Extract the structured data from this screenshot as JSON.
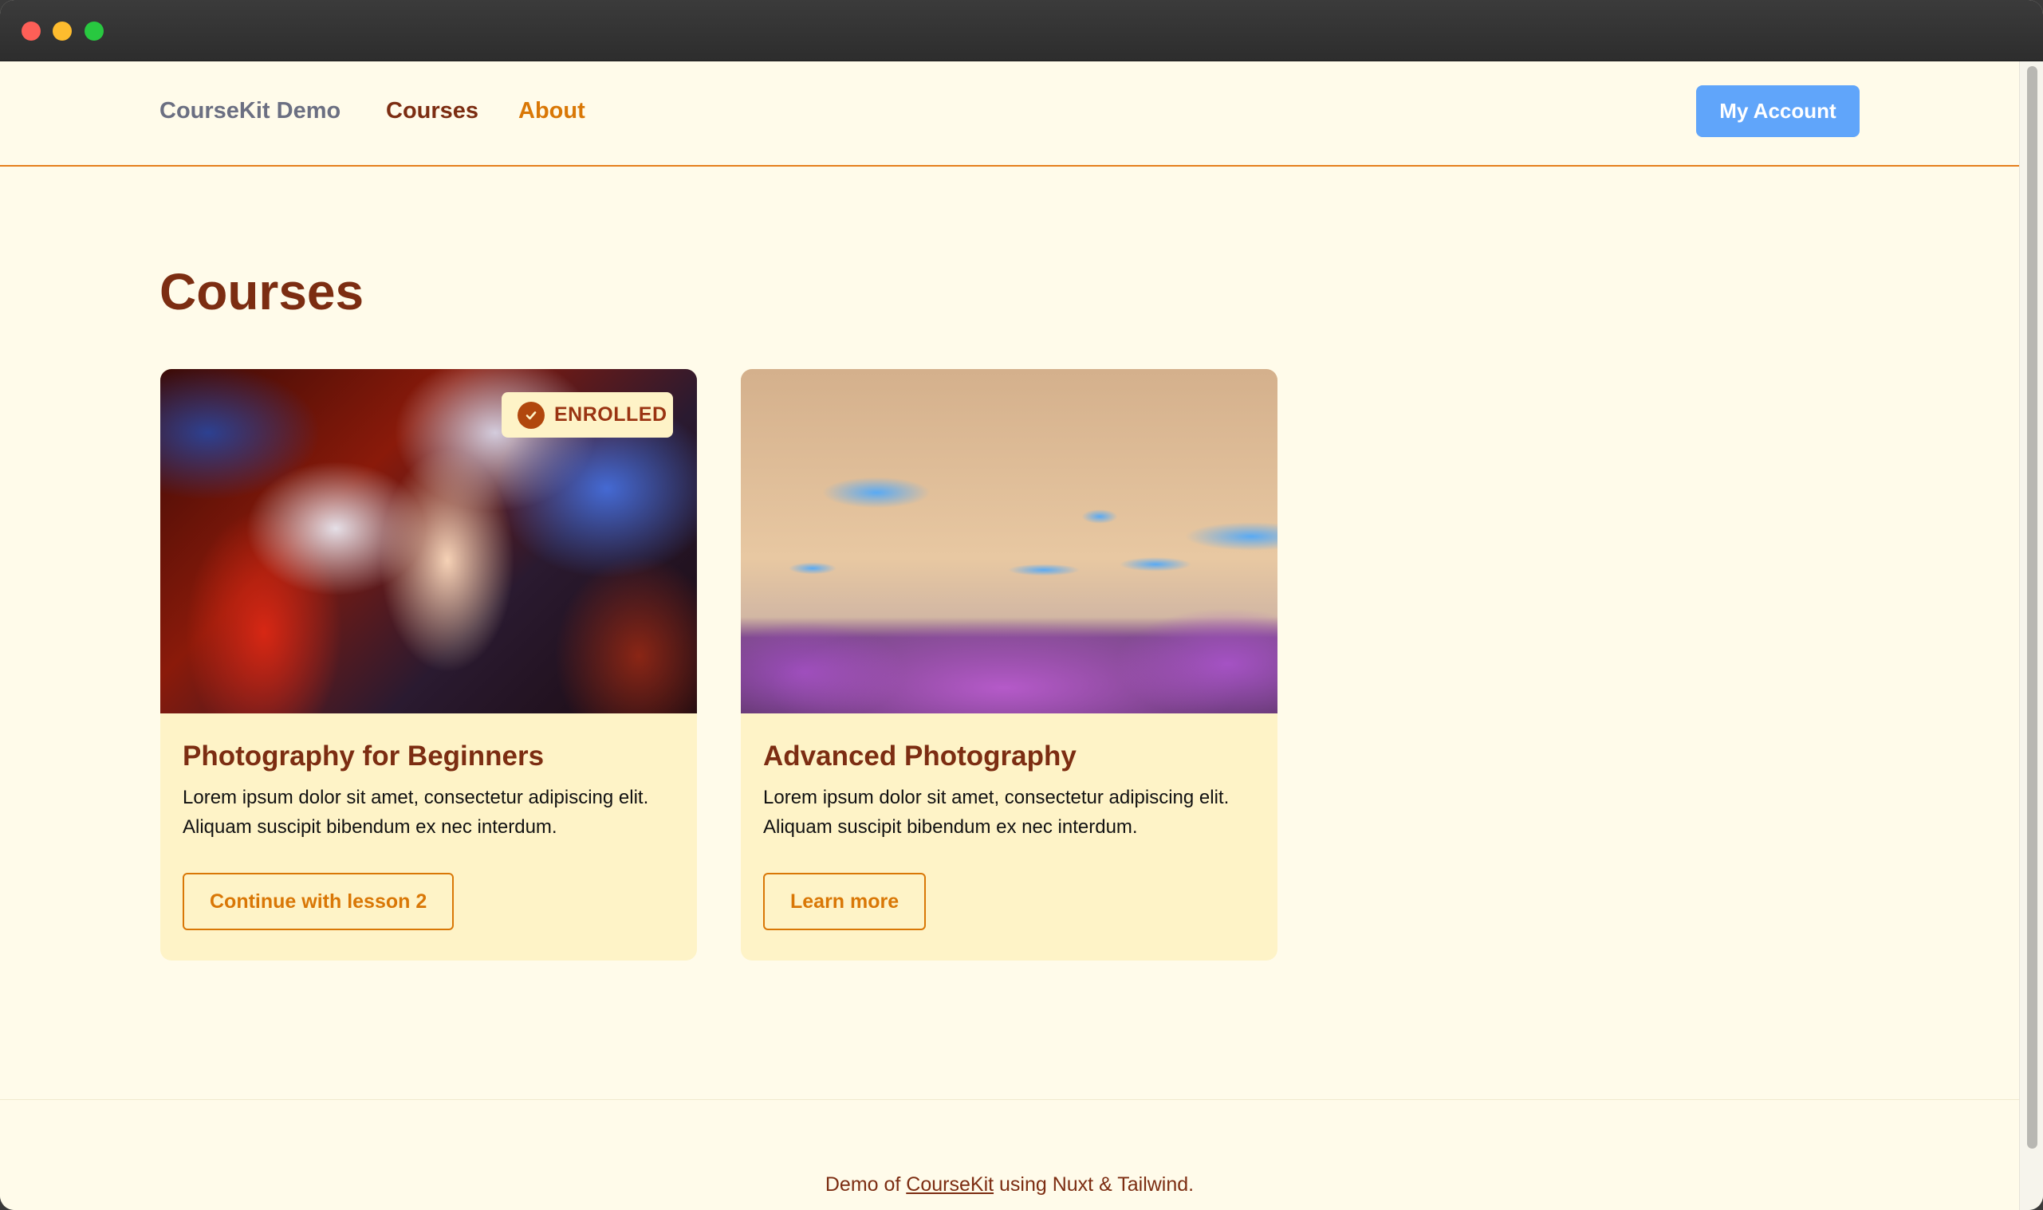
{
  "window": {
    "controls": [
      "close",
      "minimize",
      "zoom"
    ]
  },
  "nav": {
    "brand": "CourseKit Demo",
    "links": [
      {
        "label": "Courses",
        "active": true
      },
      {
        "label": "About",
        "active": false
      }
    ],
    "account_button": "My Account"
  },
  "page": {
    "title": "Courses"
  },
  "courses": [
    {
      "title": "Photography for Beginners",
      "description": "Lorem ipsum dolor sit amet, consectetur adipiscing elit. Aliquam suscipit bibendum ex nec interdum.",
      "badge": "ENROLLED",
      "badge_icon": "check-circle-icon",
      "image": "colorful-smoke-photo",
      "action": "Continue with lesson 2"
    },
    {
      "title": "Advanced Photography",
      "description": "Lorem ipsum dolor sit amet, consectetur adipiscing elit. Aliquam suscipit bibendum ex nec interdum.",
      "image": "purple-grass-field-photo",
      "action": "Learn more"
    }
  ],
  "footer": {
    "prefix": "Demo of ",
    "link": "CourseKit",
    "suffix": " using Nuxt & Tailwind."
  },
  "colors": {
    "background": "#fffbea",
    "heading": "#7c2d12",
    "accent": "#d97706",
    "card": "#fef3c7",
    "primary_button": "#60a5fa"
  }
}
